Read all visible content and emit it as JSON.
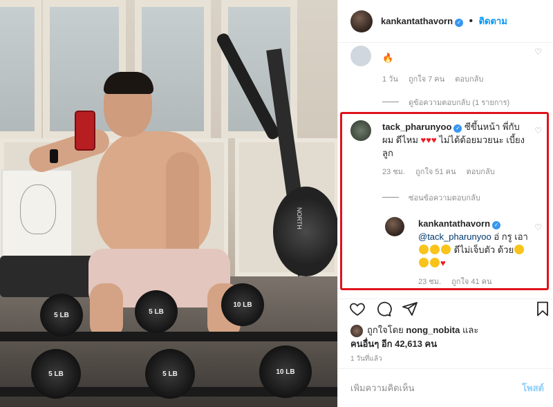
{
  "header": {
    "username": "kankantathavorn",
    "verified_glyph": "✓",
    "separator": "•",
    "follow_label": "ติดตาม"
  },
  "comments": {
    "top_partial": {
      "text_glyph": "🔥",
      "time": "1 วัน",
      "likes": "ถูกใจ 7 คน",
      "reply_label": "ตอบกลับ",
      "view_replies": "ดูข้อความตอบกลับ (1 รายการ)"
    },
    "highlighted": {
      "username": "tack_pharunyoo",
      "text_before_hearts": "ซีขึ้นหน้า พี่กับผม ดีไหม",
      "hearts": "♥♥♥",
      "text_after_hearts": "ไม่ได้ด้อยมวยนะ เบี้ยงลูก",
      "time": "23 ชม.",
      "likes": "ถูกใจ 51 คน",
      "reply_label": "ตอบกลับ",
      "hide_replies": "ซ่อนข้อความตอบกลับ"
    },
    "reply": {
      "username": "kankantathavorn",
      "mention": "@tack_pharunyoo",
      "text_part1": "อ่ กรู",
      "text_part2": "เอา",
      "text_part3": "ดีไม่เจ็บตัว",
      "text_part4": "ด้วย",
      "heart": "♥",
      "time": "23 ชม.",
      "likes": "ถูกใจ 41 คน"
    }
  },
  "actions": {
    "like_icon": "heart-outline-icon",
    "comment_icon": "comment-bubble-icon",
    "share_icon": "paper-plane-icon",
    "save_icon": "bookmark-icon"
  },
  "likes_summary": {
    "prefix": "ถูกใจโดย",
    "user": "nong_nobita",
    "and": "และ",
    "others": "คนอื่นๆ อีก 42,613 คน"
  },
  "posted_time": "1 วันที่แล้ว",
  "add_comment": {
    "placeholder": "เพิ่มความคิดเห็น",
    "post_label": "โพสต์"
  },
  "photo": {
    "dumbbell_labels": [
      "5 LB",
      "5 LB",
      "10 LB",
      "5 LB",
      "5 LB",
      "10 LB"
    ],
    "brand": "NORTH",
    "machine_label": "NORTH"
  },
  "colors": {
    "highlight_border": "#e0121b",
    "link_blue": "#0095f6",
    "muted_gray": "#8e8e8e",
    "heart_red": "#ed1c24"
  }
}
